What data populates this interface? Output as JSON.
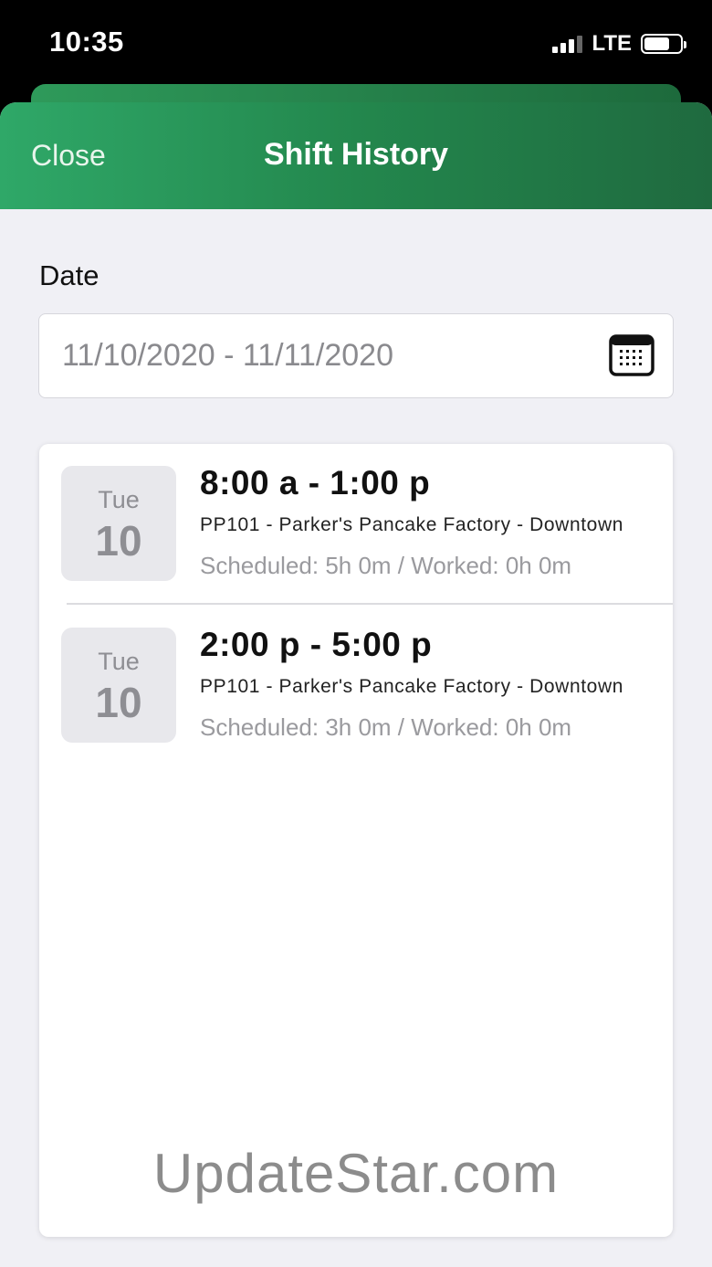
{
  "status_bar": {
    "time": "10:35",
    "network": "LTE"
  },
  "nav": {
    "close_label": "Close",
    "title": "Shift History"
  },
  "filter": {
    "date_label": "Date",
    "date_range": "11/10/2020 - 11/11/2020"
  },
  "shifts": [
    {
      "day_name": "Tue",
      "day_num": "10",
      "time": "8:00 a - 1:00 p",
      "location": "PP101 - Parker's Pancake Factory - Downtown",
      "hours": "Scheduled: 5h 0m / Worked: 0h 0m"
    },
    {
      "day_name": "Tue",
      "day_num": "10",
      "time": "2:00 p - 5:00 p",
      "location": "PP101 - Parker's Pancake Factory - Downtown",
      "hours": "Scheduled: 3h 0m / Worked: 0h 0m"
    }
  ],
  "watermark": "UpdateStar.com",
  "colors": {
    "header_start": "#2fa868",
    "header_end": "#1f6a3f",
    "background": "#f0f0f5"
  }
}
